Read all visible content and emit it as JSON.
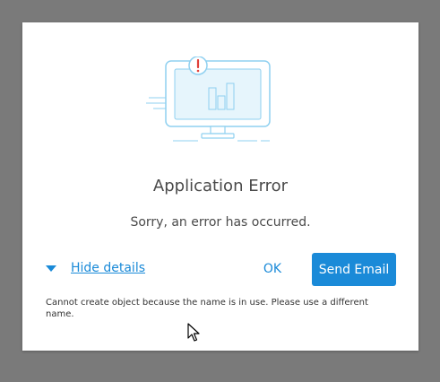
{
  "dialog": {
    "title": "Application Error",
    "message": "Sorry, an error has occurred.",
    "details_toggle_label": "Hide details",
    "ok_label": "OK",
    "send_email_label": "Send Email",
    "detail_text": "Cannot create object because the name is in use. Please use a different name."
  },
  "icons": {
    "illustration": "monitor-error-icon",
    "alert": "exclamation-icon",
    "caret": "caret-down-icon",
    "cursor": "mouse-pointer-icon"
  },
  "colors": {
    "accent": "#1a8ad8",
    "overlay": "#7a7a7a",
    "illustration_line": "#8fd0f0",
    "alert_red": "#e0403a"
  }
}
